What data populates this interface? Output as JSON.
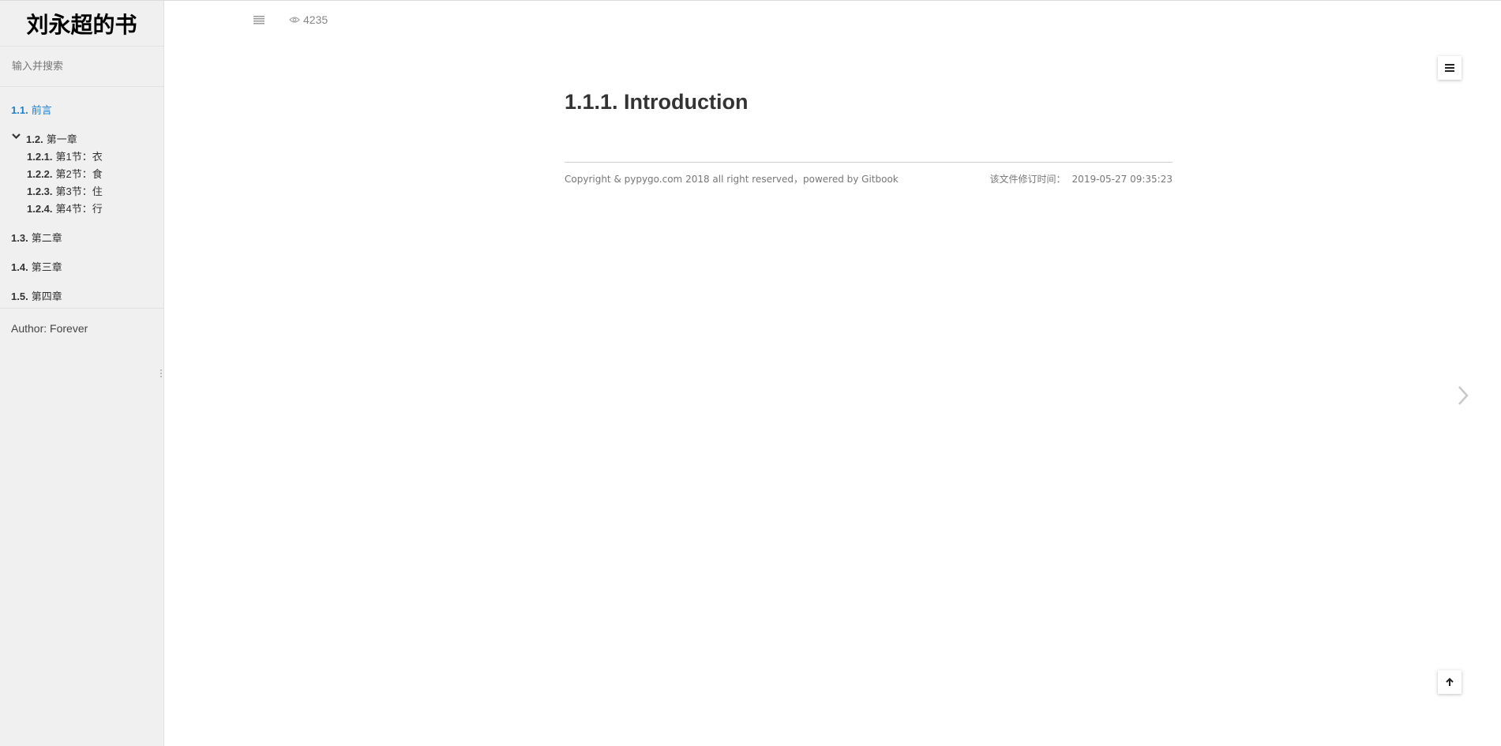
{
  "sidebar": {
    "book_title": "刘永超的书",
    "search_placeholder": "输入并搜索",
    "items": [
      {
        "num": "1.1.",
        "label": "前言"
      },
      {
        "num": "1.2.",
        "label": "第一章"
      },
      {
        "num": "1.2.1.",
        "label": "第1节：衣"
      },
      {
        "num": "1.2.2.",
        "label": "第2节：食"
      },
      {
        "num": "1.2.3.",
        "label": "第3节：住"
      },
      {
        "num": "1.2.4.",
        "label": "第4节：行"
      },
      {
        "num": "1.3.",
        "label": "第二章"
      },
      {
        "num": "1.4.",
        "label": "第三章"
      },
      {
        "num": "1.5.",
        "label": "第四章"
      }
    ],
    "author": "Author: Forever"
  },
  "header": {
    "views": "4235"
  },
  "main": {
    "title": "1.1.1. Introduction",
    "copyright_prefix": "Copyright & pypygo.com 2018 all right reserved，powered by ",
    "copyright_link": "Gitbook",
    "modified_label": "该文件修订时间：",
    "modified_time": "2019-05-27 09:35:23"
  },
  "colors": {
    "active_link": "#1a7ed4",
    "sidebar_bg": "#f0f0f0"
  },
  "icons": [
    "menu-icon",
    "eye-icon",
    "chevron-down-icon",
    "toc-icon",
    "arrow-up-icon",
    "chevron-right-icon"
  ]
}
